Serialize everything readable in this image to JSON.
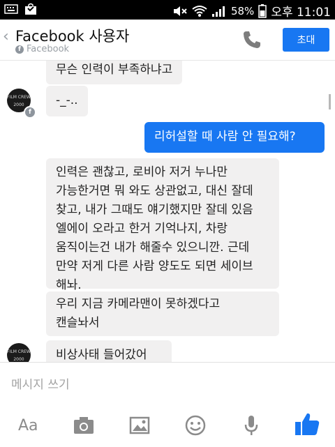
{
  "status_bar": {
    "battery": "58%",
    "time": "오후 11:01"
  },
  "header": {
    "title": "Facebook 사용자",
    "subtitle": "Facebook",
    "invite_label": "초대"
  },
  "messages": [
    {
      "side": "in",
      "text": "무슨 인력이 부족하냐고"
    },
    {
      "side": "in",
      "text": "-_-.."
    },
    {
      "side": "out",
      "text": "리허설할 때 사람 안 필요해?"
    },
    {
      "side": "in",
      "text": "인력은 괜찮고, 로비아 저거 누나만\n가능한거면 뭐 와도 상관없고, 대신 잘데\n찾고, 내가 그때도 얘기했지만 잘데 있음\n엘에이 오라고 한거 기억나지, 차랑\n움직이는건 내가 해줄수 있으니깐. 근데\n만약 저게 다른 사람 양도도 되면 세이브\n해놔."
    },
    {
      "side": "in",
      "text": "우리 지금 카메라맨이 못하겠다고\n캔슬놔서"
    },
    {
      "side": "in",
      "text": "비상사태 들어갔어"
    }
  ],
  "avatar": {
    "text_top": "FILM CREW",
    "text_bottom": "2000"
  },
  "composer": {
    "placeholder": "메시지 쓰기",
    "aa_label": "Aa",
    "icons": [
      "camera-icon",
      "gallery-icon",
      "emoji-icon",
      "microphone-icon",
      "thumbs-up-icon"
    ]
  },
  "colors": {
    "accent": "#1877f2",
    "incoming_bubble": "#f1f0f0",
    "icon_gray": "#8b8b8b"
  }
}
